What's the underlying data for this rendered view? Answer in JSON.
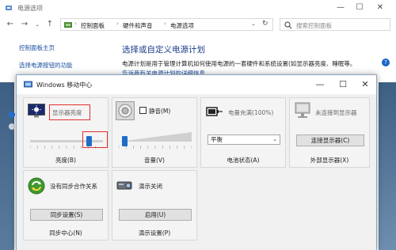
{
  "background_window": {
    "title": "电源选项",
    "nav": {
      "back": "←",
      "forward": "→",
      "up": "↑",
      "refresh": "↻"
    },
    "breadcrumb": [
      "控制面板",
      "硬件和声音",
      "电源选项"
    ],
    "breadcrumb_separator": "›",
    "search_placeholder": "搜索控制面板",
    "left_links": [
      "控制面板主页",
      "选择电源按钮的功能"
    ],
    "heading": "选择或自定义电源计划",
    "description": "电源计划是用于管理计算机如何使用电源的一套硬件和系统设置(如显示器亮度、睡眠等。",
    "description_link": "告诉我有关电源计划的详细信息",
    "help": "?"
  },
  "mobility_center": {
    "title": "Windows 移动中心",
    "window_buttons": {
      "minimize": "—",
      "maximize": "☐",
      "close": "✕"
    },
    "tiles": {
      "brightness": {
        "label": "显示器亮度",
        "caption": "亮度(B)",
        "level": 0.83
      },
      "volume": {
        "mute_label": "静音(M)",
        "muted": false,
        "caption": "音量(V)",
        "level": 0.05
      },
      "battery": {
        "label": "电量充满(100%)",
        "plan_value": "平衡",
        "caption": "电池状态(A)"
      },
      "display": {
        "label": "未连接到显示器",
        "button": "连接显示器(C)",
        "caption": "外部显示器(X)"
      },
      "sync": {
        "label": "没有同步合作关系",
        "button": "同步设置(S)",
        "caption": "同步中心(N)"
      },
      "presentation": {
        "label": "演示关闭",
        "button": "启用(U)",
        "caption": "演示设置(P)"
      }
    }
  },
  "colors": {
    "accent": "#1e6ec8",
    "highlight_box": "#e23030",
    "link": "#1a4fa0"
  }
}
